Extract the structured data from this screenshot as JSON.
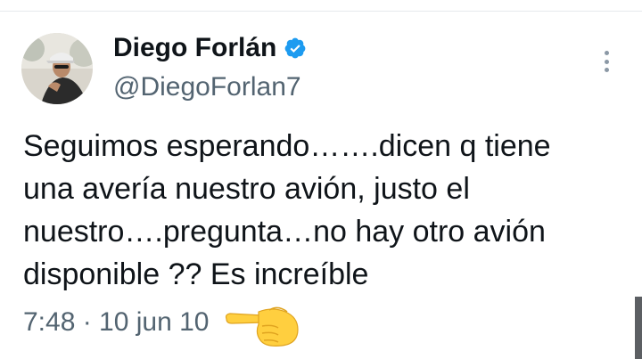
{
  "tweet": {
    "display_name": "Diego Forlán",
    "handle": "@DiegoForlan7",
    "text_lines": [
      "Seguimos esperando…….dicen q tiene",
      "una avería nuestro avión, justo el",
      "nuestro….pregunta…no hay otro avión",
      "disponible ?? Es increíble"
    ],
    "timestamp": "7:48 · 10 jun 10"
  },
  "icons": {
    "verified": "verified-badge-icon",
    "more": "more-options-icon",
    "emoji": "backhand-index-pointing-right-emoji"
  },
  "colors": {
    "text": "#0f1419",
    "secondary": "#536471",
    "verified": "#1d9bf0"
  }
}
